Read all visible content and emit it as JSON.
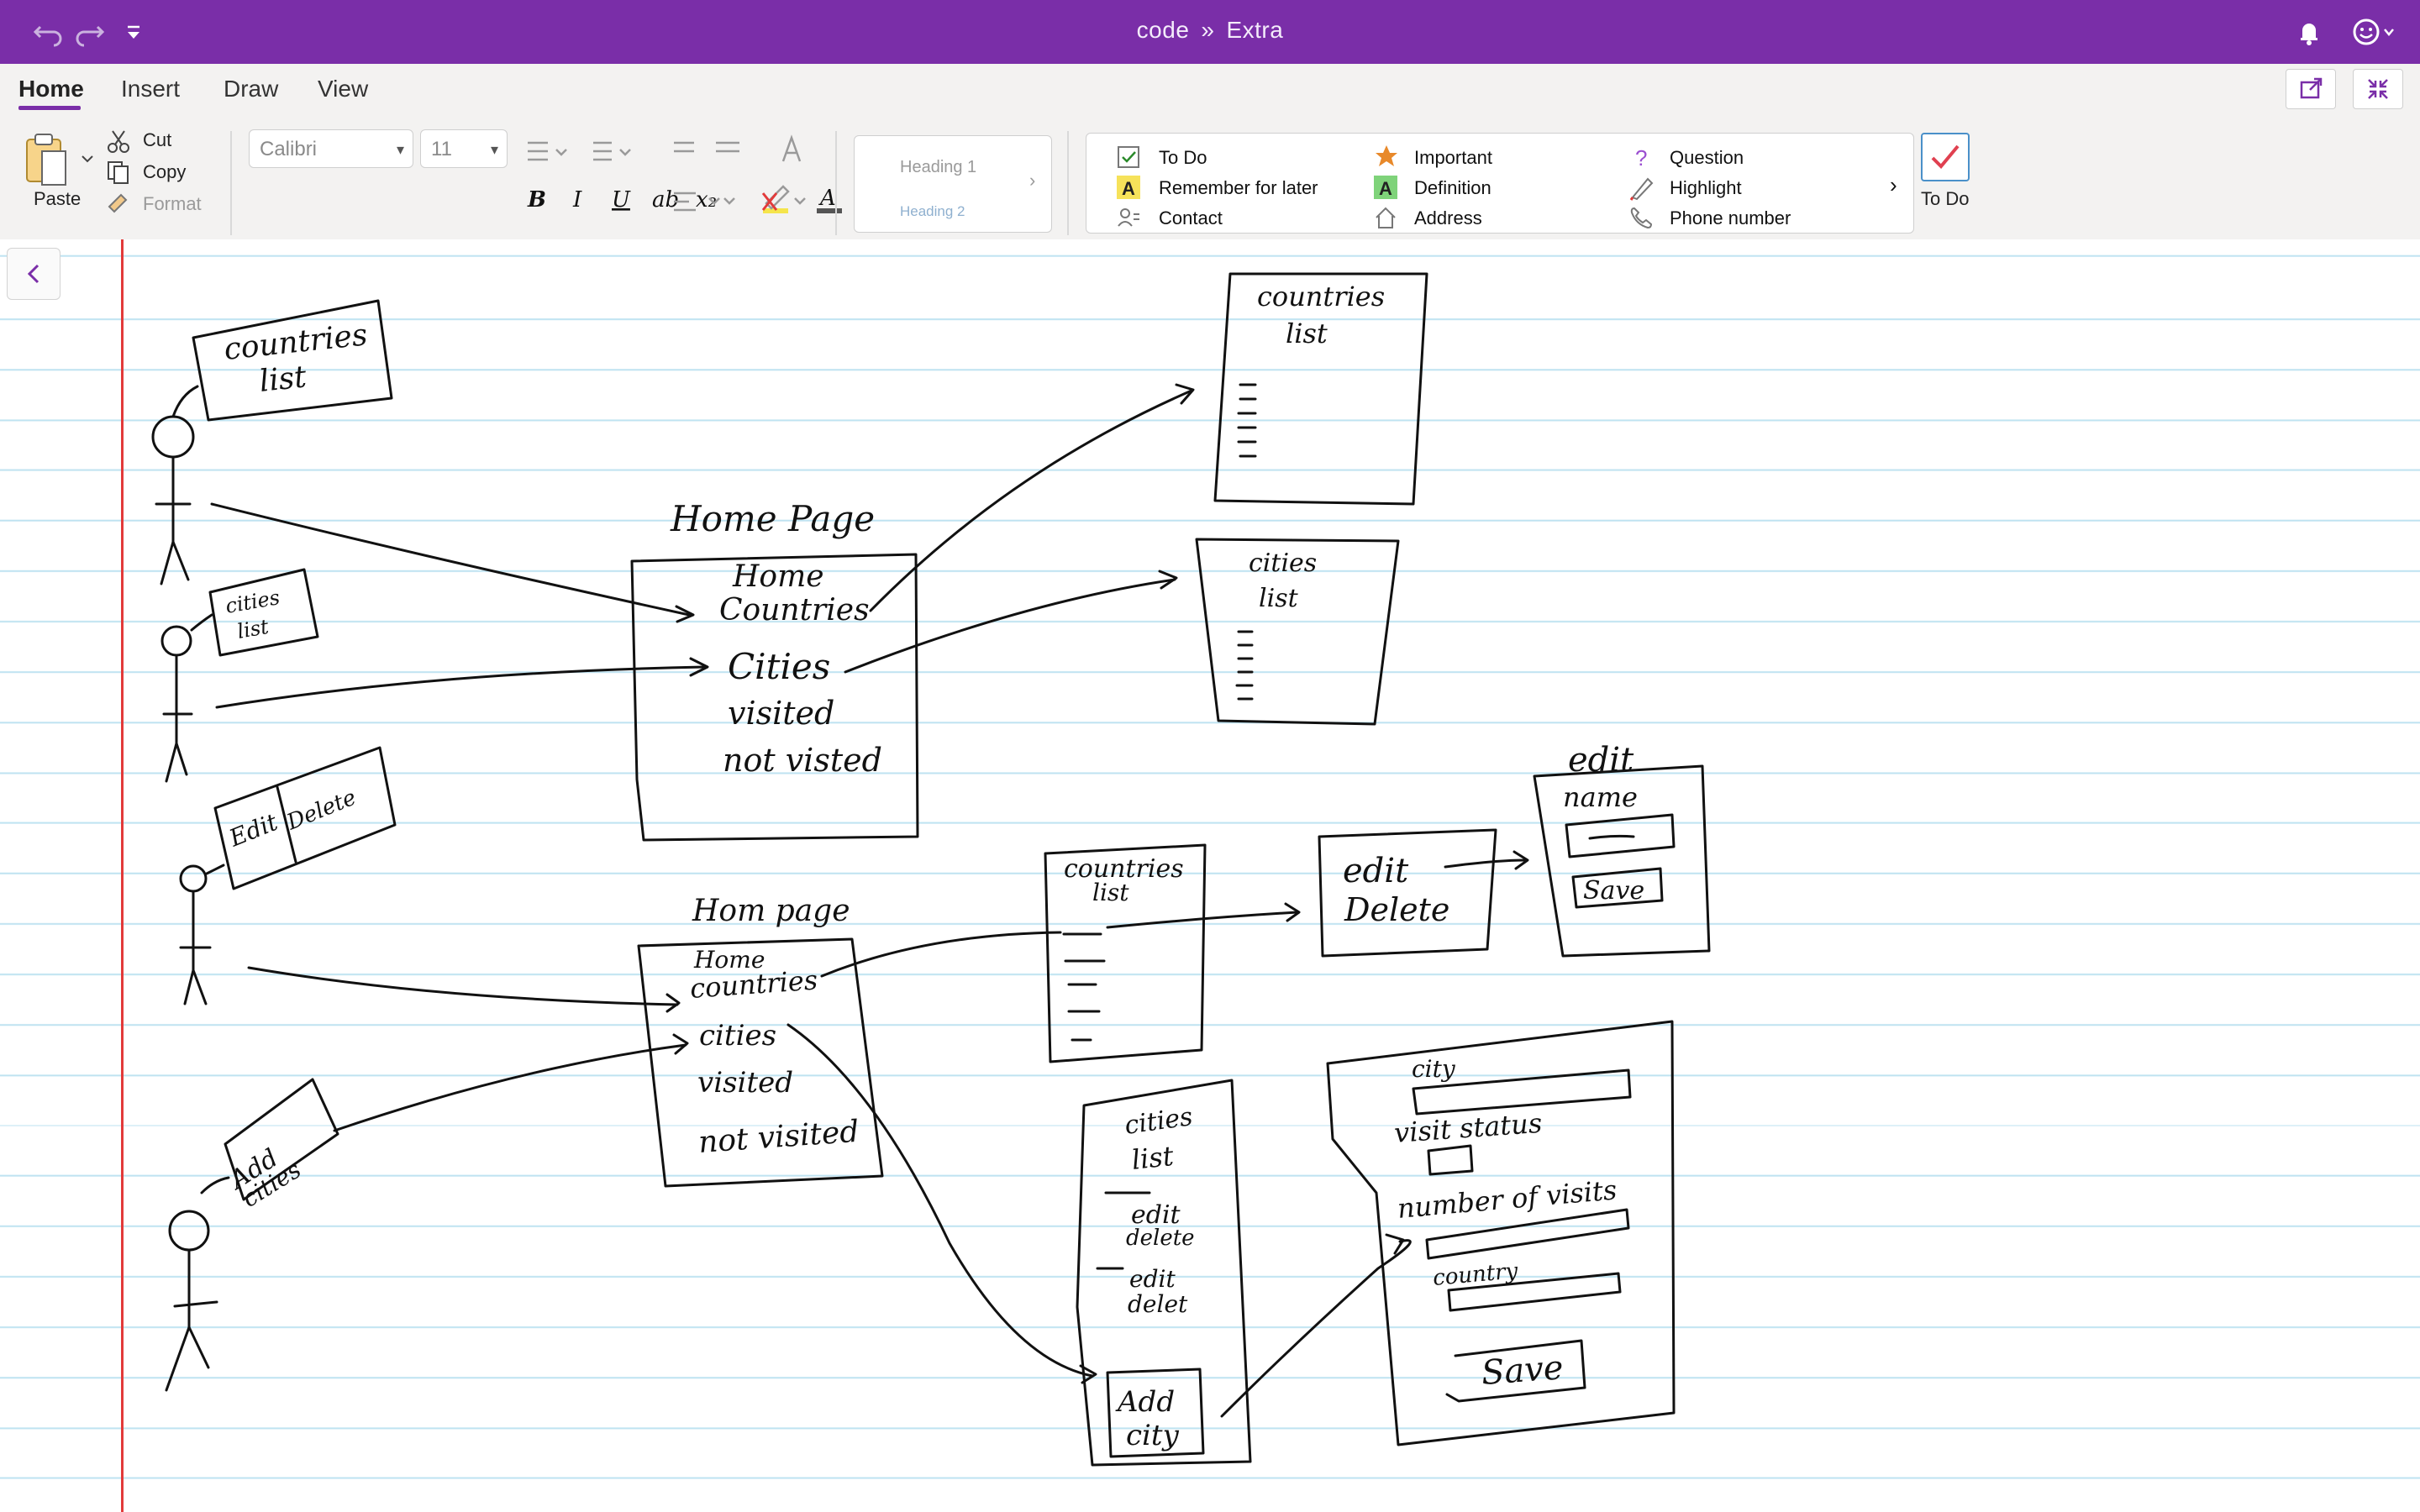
{
  "titlebar": {
    "notebook": "code",
    "separator": "»",
    "section": "Extra",
    "bg_color": "#7a2ea8",
    "icons": [
      "undo-icon",
      "redo-icon",
      "customize-toolbar-icon",
      "bell-icon",
      "emoji-feedback-icon"
    ]
  },
  "tabs": [
    {
      "label": "Home",
      "active": true
    },
    {
      "label": "Insert",
      "active": false
    },
    {
      "label": "Draw",
      "active": false
    },
    {
      "label": "View",
      "active": false
    }
  ],
  "clipboard": {
    "paste": "Paste",
    "cut": "Cut",
    "copy": "Copy",
    "format": "Format"
  },
  "font": {
    "family": "Calibri",
    "size": "11"
  },
  "styles": {
    "heading1": "Heading 1",
    "heading2": "Heading 2"
  },
  "tags": {
    "col1": [
      "To Do",
      "Remember for later",
      "Contact"
    ],
    "col2": [
      "Important",
      "Definition",
      "Address"
    ],
    "col3": [
      "Question",
      "Highlight",
      "Phone number"
    ]
  },
  "todo_button": "To Do",
  "sketch": {
    "group1_actor_box": [
      "countries",
      "list"
    ],
    "group1_actor2_box": [
      "cities",
      "list"
    ],
    "group1_page_title": "Home Page",
    "group1_page_items": [
      "Home",
      "Countries",
      "Cities",
      "visited",
      "not visted"
    ],
    "group1_countries_list": [
      "countries",
      "list"
    ],
    "group1_cities_list": [
      "cities",
      "list"
    ],
    "group2_actor_box": [
      "Edit",
      "Delete"
    ],
    "group2_page_title": "Hom page",
    "group2_page_items": [
      "Home",
      "countries",
      "cities",
      "visited",
      "not visited"
    ],
    "group2_countries_list": [
      "countries",
      "list"
    ],
    "edit_delete_box": [
      "edit",
      "Delete"
    ],
    "edit_form_title": "edit",
    "edit_form": [
      "name",
      "Save"
    ],
    "group3_actor_box": [
      "Add",
      "cities"
    ],
    "group3_cities_list": [
      "cities",
      "list",
      "edit",
      "delete",
      "edit",
      "delet"
    ],
    "add_city_button": [
      "Add",
      "city"
    ],
    "city_form": [
      "city",
      "visit status",
      "number of visits",
      "country",
      "Save"
    ]
  }
}
